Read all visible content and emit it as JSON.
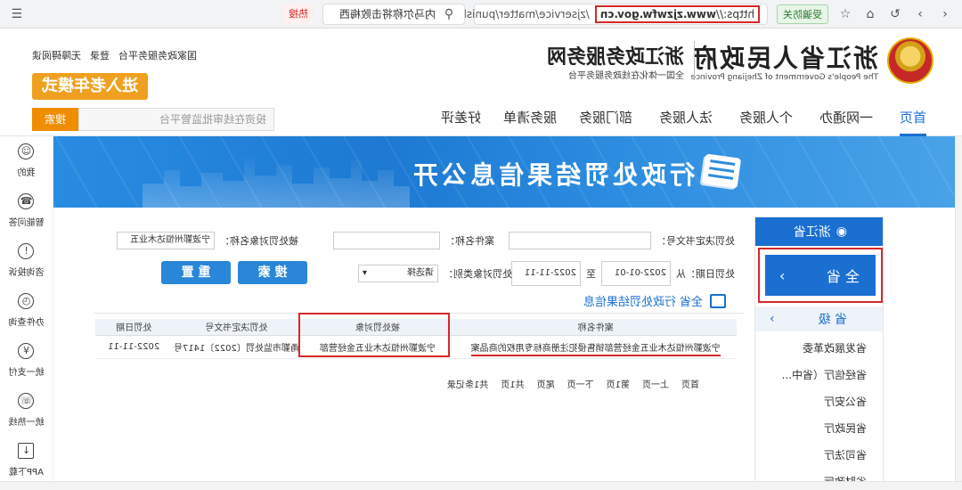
{
  "browser": {
    "url_scheme": "https://",
    "url_host": "www.zjzwfw.gov.cn",
    "url_path": "/zjservice/matter/punishr",
    "search_hint": "内马尔称将击败梅西",
    "hot_badge": "热搜",
    "scam_label": "受骗防关",
    "icon_names": [
      "back-icon",
      "forward-icon",
      "refresh-icon",
      "home-icon",
      "star-icon",
      "menu-icon",
      "lock-icon",
      "search-icon"
    ]
  },
  "header": {
    "site_title": "浙江省人民政府",
    "site_subtitle": "The People's Government of Zhejiang Province",
    "service_title": "浙江政务服务网",
    "service_subtitle": "全国一体化在线政务服务平台",
    "top_links": [
      "国家政务服务平台",
      "登录",
      "无障碍阅读"
    ],
    "elder_mode": "进入老年模式"
  },
  "nav": {
    "items": [
      "首页",
      "一网通办",
      "个人服务",
      "法人服务",
      "部门服务",
      "服务清单",
      "好差评"
    ],
    "active": "首页",
    "search_placeholder": "投资在线审批监管平台",
    "search_button": "搜索"
  },
  "banner": {
    "title": "行政处罚结果信息公开"
  },
  "region": {
    "header": "浙江省",
    "all_label": "全 省",
    "level_label": "省 级",
    "departments": [
      "省发展改革委",
      "省经信厅（省中...",
      "省公安厅",
      "省民政厅",
      "省司法厅",
      "省财政厅"
    ]
  },
  "filters": {
    "decision_no_label": "处罚决定书文号：",
    "case_name_label": "案件名称：",
    "target_name_label": "被处罚对象名称：",
    "target_name_value": "宁波鄞州恒达木业五",
    "date_label": "处罚日期：从",
    "date_from": "2022-01-01",
    "date_to_label": "至",
    "date_to": "2022-11-11",
    "target_type_label": "处罚对象类别：",
    "target_type_value": "请选择",
    "search_button": "搜 索",
    "reset_button": "重 置"
  },
  "list": {
    "title": "全省 行政处罚结果信息",
    "columns": [
      "案件名称",
      "被处罚对象",
      "处罚决定书文号",
      "处罚日期"
    ],
    "rows": [
      {
        "case_name": "宁波鄞州恒达木业五金经营部销售侵犯注册商标专用权的商品案",
        "target": "宁波鄞州恒达木业五金经营部",
        "decision_no": "甬鄞市监处罚〔2022〕1417号",
        "date": "2022-11-11"
      }
    ]
  },
  "pager": {
    "first": "首页",
    "prev": "上一页",
    "page_info": "第1页",
    "next": "下一页",
    "last": "尾页",
    "total_pages": "共1页",
    "total_records": "共1条记录"
  },
  "rail": {
    "items": [
      {
        "label": "我的",
        "icon": "user-icon"
      },
      {
        "label": "智能问答",
        "icon": "headset-icon"
      },
      {
        "label": "咨询投诉",
        "icon": "alert-icon"
      },
      {
        "label": "办件查询",
        "icon": "clock-icon"
      },
      {
        "label": "统一支付",
        "icon": "yen-icon"
      },
      {
        "label": "统一热线",
        "icon": "phone-icon"
      },
      {
        "label": "APP下载",
        "icon": "download-icon"
      }
    ]
  },
  "colors": {
    "primary": "#1a6fd1",
    "accent_orange": "#f0a020",
    "highlight_red": "#d62828"
  }
}
